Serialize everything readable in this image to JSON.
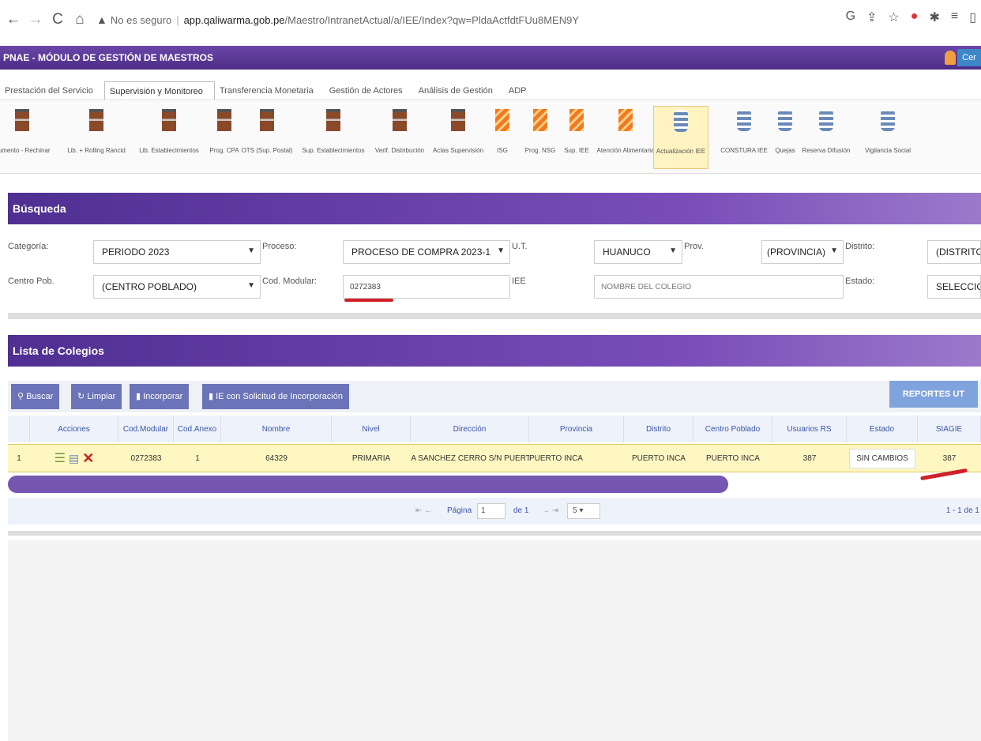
{
  "browser": {
    "security": "No es seguro",
    "host": "app.qaliwarma.gob.pe",
    "path": "/Maestro/IntranetActual/a/IEE/Index?qw=PldaActfdtFUu8MEN9Y"
  },
  "app": {
    "title": "PNAE - MÓDULO DE GESTIÓN DE MAESTROS",
    "user_label": "Cer"
  },
  "tabs": [
    "Prestación del Servicio",
    "Supervisión y Monitoreo",
    "Transferencia Monetaria",
    "Gestión de Actores",
    "Análisis de Gestión",
    "ADP"
  ],
  "ribbon": [
    {
      "label": "Aumento - Rechinar",
      "icon": "building-icon"
    },
    {
      "label": "Lib. + Rolling Rancid",
      "icon": "building-icon"
    },
    {
      "label": "Lib. Establecimientos",
      "icon": "building-icon"
    },
    {
      "label": "Prog. CPA",
      "icon": "building-icon"
    },
    {
      "label": "OTS (Sup. Postal)",
      "icon": "building-icon"
    },
    {
      "label": "Sup. Establecimientos",
      "icon": "building-icon"
    },
    {
      "label": "Verif. Distribución",
      "icon": "building-icon"
    },
    {
      "label": "Actas Supervisión",
      "icon": "building-icon"
    },
    {
      "label": "ISG",
      "icon": "stack-icon"
    },
    {
      "label": "Prog. NSG",
      "icon": "stack-icon"
    },
    {
      "label": "Sup. IEE",
      "icon": "stack-icon"
    },
    {
      "label": "Atención Alimentaria",
      "icon": "stack-icon"
    },
    {
      "label": "Actualización IEE",
      "icon": "database-icon"
    },
    {
      "label": "CONSTURA IEE",
      "icon": "database-icon"
    },
    {
      "label": "Quejas",
      "icon": "database-icon"
    },
    {
      "label": "Reserva Difusión",
      "icon": "database-icon"
    },
    {
      "label": "Vigilancia Social",
      "icon": "database-icon"
    }
  ],
  "search": {
    "section_title": "Búsqueda",
    "convocatoria_label": "Categoría:",
    "convocatoria_value": "PERIODO 2023",
    "proceso_label": "Proceso:",
    "proceso_value": "PROCESO DE COMPRA 2023-1",
    "ut_label": "U.T.",
    "ut_value": "HUANUCO",
    "prov_label": "Prov.",
    "prov_value": "(PROVINCIA)",
    "distrito_label": "Distrito:",
    "distrito_value": "(DISTRITO)",
    "centro_label": "Centro Pob.",
    "centro_value": "(CENTRO POBLADO)",
    "cod_label": "Cod. Modular:",
    "cod_value": "0272383",
    "iee_label": "IEE",
    "iee_placeholder": "NOMBRE DEL COLEGIO",
    "estado_label": "Estado:",
    "estado_value": "SELECCIONE"
  },
  "list": {
    "section_title": "Lista de Colegios",
    "buttons": {
      "buscar": "Buscar",
      "limpiar": "Limpiar",
      "incorporar": "Incorporar",
      "solicitud": "IE con Solicitud de Incorporación"
    },
    "reportes": "REPORTES UT",
    "columns": [
      "Acciones",
      "Cod.Modular",
      "Cod.Anexo",
      "Nombre",
      "Nivel",
      "Dirección",
      "Provincia",
      "Distrito",
      "Centro Poblado",
      "Usuarios RS",
      "Estado",
      "SIAGIE"
    ],
    "row": {
      "index": "1",
      "cod_modular": "0272383",
      "cod_anexo": "1",
      "nombre": "64329",
      "nivel": "PRIMARIA",
      "direccion": "AVENIDA SANCHEZ CERRO S/N PUERTO INCA",
      "provincia": "PUERTO INCA",
      "distrito": "PUERTO INCA",
      "centro": "PUERTO INCA",
      "usuarios": "387",
      "estado": "SIN CAMBIOS",
      "siagie": "387"
    },
    "pager": {
      "page_label": "Página",
      "page_value": "1",
      "of_label": "de 1",
      "per_page": "5",
      "summary": "1 - 1 de 1"
    }
  }
}
